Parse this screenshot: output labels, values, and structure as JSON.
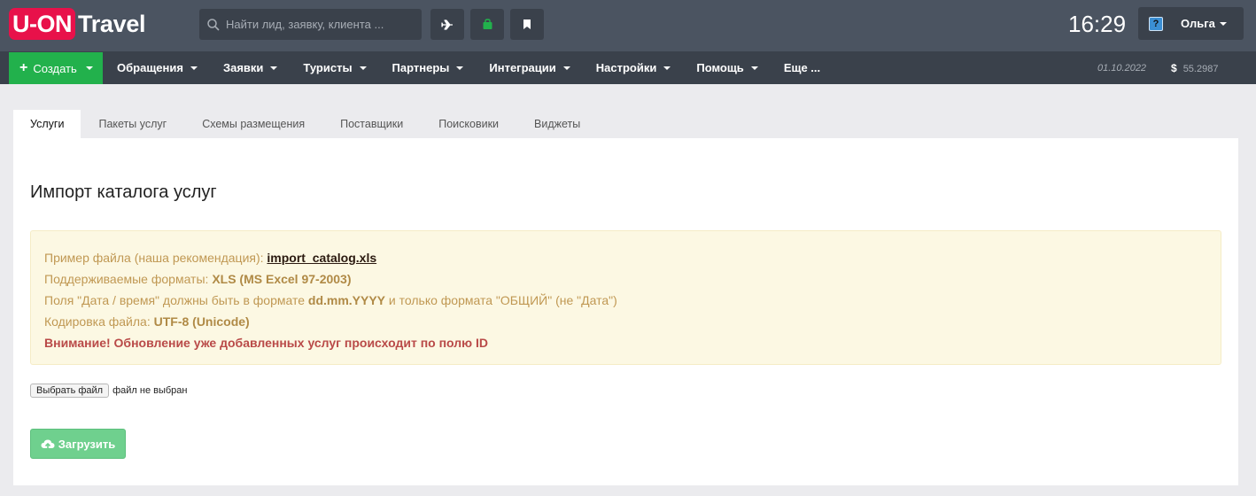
{
  "header": {
    "logo_badge": "U-ON",
    "logo_text": "Travel",
    "search_placeholder": "Найти лид, заявку, клиента ...",
    "clock": "16:29",
    "user_name": "Ольга",
    "help_glyph": "?"
  },
  "icons": {
    "search": "search-icon",
    "plane": "plane-icon",
    "bag": "bag-icon",
    "bookmark": "bookmark-icon",
    "help": "help-icon",
    "cloud_upload": "cloud-upload-icon"
  },
  "colors": {
    "topbar": "#4b5461",
    "navbar": "#3a414b",
    "create": "#22b14c",
    "logo": "#e8114a",
    "bag": "#22b14c",
    "upload": "#6fd08e",
    "notice_bg": "#fcf8e3",
    "notice_text": "#c09853",
    "warning": "#b94a48"
  },
  "nav": {
    "create_label": "Создать",
    "items": [
      {
        "label": "Обращения"
      },
      {
        "label": "Заявки"
      },
      {
        "label": "Туристы"
      },
      {
        "label": "Партнеры"
      },
      {
        "label": "Интеграции"
      },
      {
        "label": "Настройки"
      },
      {
        "label": "Помощь"
      },
      {
        "label": "Еще ..."
      }
    ],
    "date": "01.10.2022",
    "currency_symbol": "$",
    "rate": "55.2987"
  },
  "tabs": [
    {
      "label": "Услуги",
      "active": true
    },
    {
      "label": "Пакеты услуг"
    },
    {
      "label": "Схемы размещения"
    },
    {
      "label": "Поставщики"
    },
    {
      "label": "Поисковики"
    },
    {
      "label": "Виджеты"
    }
  ],
  "main": {
    "title": "Импорт каталога услуг",
    "notice": {
      "example_prefix": "Пример файла (наша рекомендация): ",
      "example_link": "import_catalog.xls",
      "formats_prefix": "Поддерживаемые форматы: ",
      "formats_value": "XLS (MS Excel 97-2003)",
      "date_prefix": "Поля \"Дата / время\" должны быть в формате ",
      "date_format": "dd.mm.YYYY",
      "date_suffix": " и только формата \"ОБЩИЙ\" (не \"Дата\")",
      "encoding_prefix": "Кодировка файла: ",
      "encoding_value": "UTF-8 (Unicode)",
      "warning": "Внимание! Обновление уже добавленных услуг происходит по полю ID"
    },
    "file_button": "Выбрать файл",
    "file_status": "файл не выбран",
    "upload_label": "Загрузить"
  }
}
